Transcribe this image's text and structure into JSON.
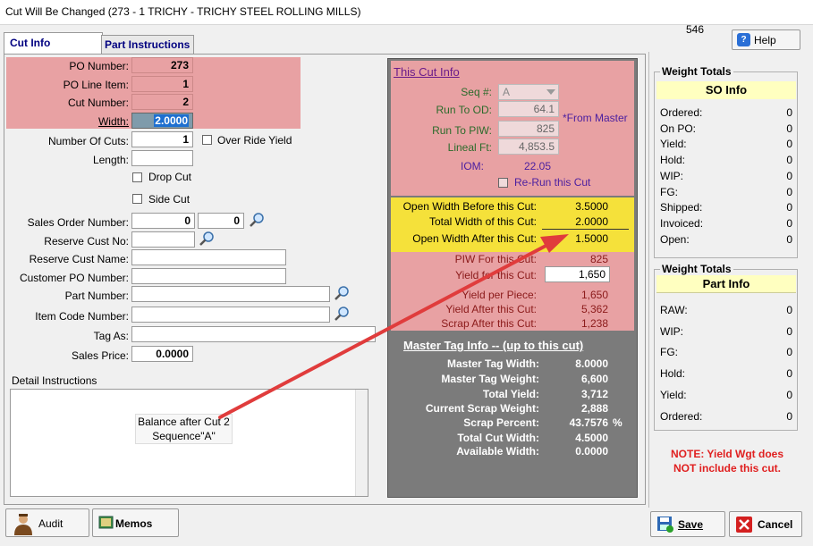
{
  "window": {
    "title": "Cut Will Be Changed  (273 - 1  TRICHY - TRICHY STEEL ROLLING MILLS)"
  },
  "header": {
    "code": "546",
    "help_label": "Help"
  },
  "tabs": [
    {
      "label": "Cut Info"
    },
    {
      "label": "Part Instructions"
    }
  ],
  "form": {
    "po_number_label": "PO Number:",
    "po_number": "273",
    "po_line_label": "PO Line Item:",
    "po_line": "1",
    "cut_number_label": "Cut Number:",
    "cut_number": "2",
    "width_label": "Width:",
    "width": "2.0000",
    "num_cuts_label": "Number Of Cuts:",
    "num_cuts": "1",
    "override_yield_label": "Over Ride Yield",
    "length_label": "Length:",
    "length": "",
    "drop_cut_label": "Drop Cut",
    "side_cut_label": "Side Cut",
    "sales_order_label": "Sales Order Number:",
    "sales_order": "0",
    "sales_order_line": "0",
    "reserve_cust_no_label": "Reserve Cust No:",
    "reserve_cust_name_label": "Reserve Cust Name:",
    "customer_po_label": "Customer PO Number:",
    "part_number_label": "Part Number:",
    "item_code_label": "Item Code Number:",
    "tag_as_label": "Tag As:",
    "sales_price_label": "Sales Price:",
    "sales_price": "0.0000",
    "detail_instructions_label": "Detail Instructions",
    "detail_line1": "Balance after Cut 2",
    "detail_line2": "Sequence\"A\""
  },
  "this_cut": {
    "title": "This Cut Info",
    "seq_label": "Seq #:",
    "seq": "A",
    "run_to_od_label": "Run To OD:",
    "run_to_od": "64.1",
    "from_master": "*From Master",
    "run_to_piw_label": "Run To PIW:",
    "run_to_piw": "825",
    "lineal_ft_label": "Lineal Ft:",
    "lineal_ft": "4,853.5",
    "iom_label": "IOM:",
    "iom": "22.05",
    "rerun_label": "Re-Run this Cut",
    "open_before_label": "Open Width Before this Cut:",
    "open_before": "3.5000",
    "total_width_label": "Total Width of this Cut:",
    "total_width": "2.0000",
    "open_after_label": "Open Width After this Cut:",
    "open_after": "1.5000",
    "piw_label": "PIW For this Cut:",
    "piw": "825",
    "yield_cut_label": "Yield for this Cut:",
    "yield_cut": "1,650",
    "yield_piece_label": "Yield per Piece:",
    "yield_piece": "1,650",
    "yield_after_label": "Yield After this Cut:",
    "yield_after": "5,362",
    "scrap_after_label": "Scrap After this Cut:",
    "scrap_after": "1,238"
  },
  "master_tag": {
    "title": "Master Tag Info -- (up to this cut)",
    "width_label": "Master Tag Width:",
    "width": "8.0000",
    "weight_label": "Master Tag Weight:",
    "weight": "6,600",
    "total_yield_label": "Total Yield:",
    "total_yield": "3,712",
    "scrap_weight_label": "Current Scrap Weight:",
    "scrap_weight": "2,888",
    "scrap_pct_label": "Scrap Percent:",
    "scrap_pct": "43.7576",
    "pct_sign": "%",
    "cut_width_label": "Total Cut Width:",
    "cut_width": "4.5000",
    "avail_width_label": "Available Width:",
    "avail_width": "0.0000"
  },
  "so_totals": {
    "group_title": "Weight Totals",
    "header": "SO Info",
    "rows": [
      {
        "label": "Ordered:",
        "value": "0"
      },
      {
        "label": "On PO:",
        "value": "0"
      },
      {
        "label": "Yield:",
        "value": "0"
      },
      {
        "label": "Hold:",
        "value": "0"
      },
      {
        "label": "WIP:",
        "value": "0"
      },
      {
        "label": "FG:",
        "value": "0"
      },
      {
        "label": "Shipped:",
        "value": "0"
      },
      {
        "label": "Invoiced:",
        "value": "0"
      },
      {
        "label": "Open:",
        "value": "0"
      }
    ]
  },
  "part_totals": {
    "group_title": "Weight Totals",
    "header": "Part Info",
    "rows": [
      {
        "label": "RAW:",
        "value": "0"
      },
      {
        "label": "WIP:",
        "value": "0"
      },
      {
        "label": "FG:",
        "value": "0"
      },
      {
        "label": "Hold:",
        "value": "0"
      },
      {
        "label": "Yield:",
        "value": "0"
      },
      {
        "label": "Ordered:",
        "value": "0"
      }
    ]
  },
  "note": {
    "line1": "NOTE: Yield Wgt does",
    "line2": "NOT include this cut."
  },
  "buttons": {
    "audit": "Audit",
    "memos": "Memos",
    "save": "Save",
    "cancel": "Cancel"
  },
  "colors": {
    "pink": "#e8a1a3",
    "yellow": "#f5e13a",
    "gray_panel": "#7b7b7b",
    "arrow": "#e03c3c"
  }
}
